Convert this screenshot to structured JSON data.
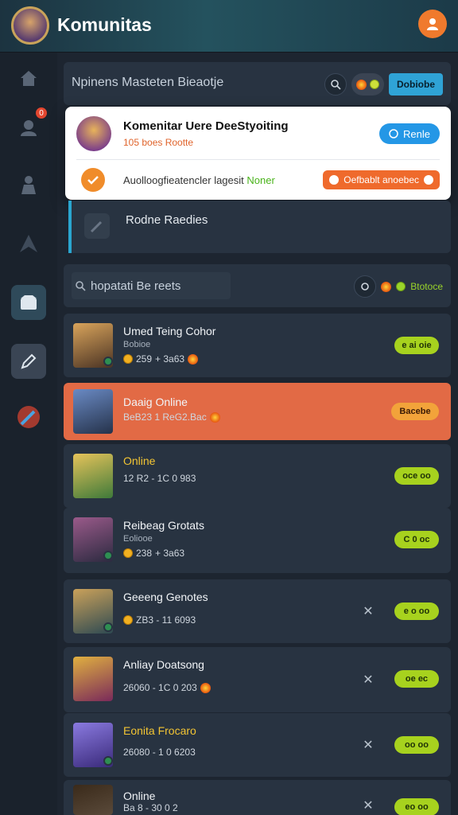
{
  "header": {
    "title": "Komunitas"
  },
  "search": {
    "text": "Npinens  Masteten Bieaotje",
    "tag": "Dobiobe"
  },
  "popup": {
    "title": "Komenitar Uere DeeStyoiting",
    "subtitle": "105 boes Rootte",
    "button": "Renle",
    "line_prefix": "Auolloogfieatencler lagesit",
    "line_highlight": "Noner",
    "action": "Oefbablt anoebec"
  },
  "section": {
    "label": "Rodne Raedies"
  },
  "search2": {
    "placeholder": "hopatati Be reets",
    "status": "Btotoce"
  },
  "rows": [
    {
      "name": "Umed Teing Cohor",
      "sub": "Bobioe",
      "meta": "259",
      "meta2": "+ 3a63",
      "button": "e ai oie",
      "active": false,
      "gold": false
    },
    {
      "name": "Daaig Online",
      "sub": "",
      "meta": "BeB23 1 ReG2.Bac",
      "meta2": "",
      "button": "Bacebe",
      "active": true,
      "gold": false
    },
    {
      "name": "Online",
      "sub": "",
      "meta": "12 R2 - 1C 0 983",
      "meta2": "",
      "button": "oce oo",
      "active": false,
      "gold": true
    },
    {
      "name": "Reibeag Grotats",
      "sub": "Eoliooe",
      "meta": "238",
      "meta2": "+ 3a63",
      "button": "C 0 oc",
      "active": false,
      "gold": false
    },
    {
      "name": "Geeeng Genotes",
      "sub": "",
      "meta": "ZB3 - 11 6093",
      "meta2": "",
      "button": "e o oo",
      "active": false,
      "gold": false
    },
    {
      "name": "Anliay Doatsong",
      "sub": "",
      "meta": "26060 - 1C 0 203",
      "meta2": "",
      "button": "oe ec",
      "active": false,
      "gold": false
    },
    {
      "name": "Eonita Frocaro",
      "sub": "",
      "meta": "26080 - 1 0 6203",
      "meta2": "",
      "button": "oo oo",
      "active": false,
      "gold": true
    },
    {
      "name": "Online",
      "sub": "",
      "meta": "Ba 8 - 30 0 2",
      "meta2": "",
      "button": "eo oo",
      "active": false,
      "gold": false
    }
  ],
  "colors": {
    "accent": "#f07a2d",
    "lime": "#a7d21e",
    "blue": "#2497e6",
    "active_row": "#e26a45"
  }
}
